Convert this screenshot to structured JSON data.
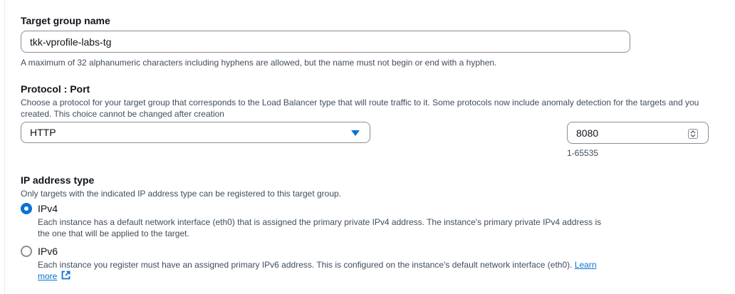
{
  "target_group_name": {
    "label": "Target group name",
    "value": "tkk-vprofile-labs-tg",
    "hint": "A maximum of 32 alphanumeric characters including hyphens are allowed, but the name must not begin or end with a hyphen."
  },
  "protocol_port": {
    "label": "Protocol : Port",
    "description_line1": "Choose a protocol for your target group that corresponds to the Load Balancer type that will route traffic to it. Some protocols now include anomaly detection for the targets and you",
    "description_line2": "created. This choice cannot be changed after creation",
    "protocol_value": "HTTP",
    "port_value": "8080",
    "port_range_hint": "1-65535"
  },
  "ip_address_type": {
    "label": "IP address type",
    "description": "Only targets with the indicated IP address type can be registered to this target group.",
    "options": [
      {
        "label": "IPv4",
        "selected": true,
        "description_line1": "Each instance has a default network interface (eth0) that is assigned the primary private IPv4 address. The instance's primary private IPv4 address is",
        "description_line2": "the one that will be applied to the target."
      },
      {
        "label": "IPv6",
        "selected": false,
        "description_line1": "Each instance you register must have an assigned primary IPv6 address. This is configured on the instance's default network interface (eth0).",
        "learn_more_part1": "Learn",
        "learn_more_part2": "more"
      }
    ]
  },
  "icons": {
    "protocol_select": "caret-down-icon",
    "port_stepper": "spinner-icon",
    "learn_more": "external-link-icon"
  },
  "colors": {
    "accent": "#0972d3",
    "text": "#0f141a",
    "muted": "#414d5c",
    "border": "#8c8c94"
  }
}
